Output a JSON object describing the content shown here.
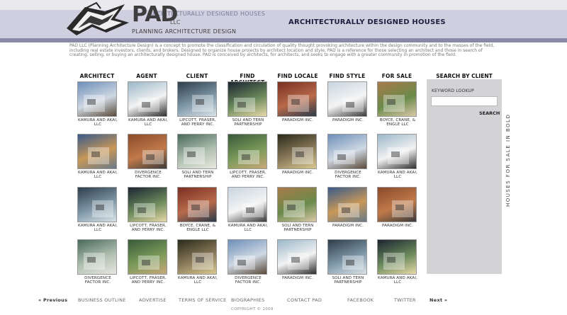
{
  "header": {
    "logo_text": "PAD",
    "logo_llc": "LLC",
    "logo_tag_top": "ARCHITECTURALLY DESIGNED HOUSES",
    "logo_tagline": "PLANNING ARCHITECTURE DESIGN",
    "title": "ARCHITECTURALLY DESIGNED HOUSES"
  },
  "intro": "PAD LLC (Planning Architecture Design) is a concept to promote the classification and circulation of quality thought provoking architecture within the design community and to the masses of the field, including real estate investors, clients, and brokers. Designed to organize house projects by architect location and style, PAD is a reference for those selecting an architect and those in search of creating, selling, or buying an architecturally designed house. PAD is conceived by architects, for architects, and seeks to engage with a greater community in promotion of the field.",
  "columns": [
    "ARCHITECT",
    "AGENT",
    "CLIENT",
    "FIND ARCHITECT",
    "FIND LOCALE",
    "FIND STYLE",
    "FOR SALE"
  ],
  "grid": [
    [
      "KAMURA AND AKAI, LLC",
      "KAMURA AND AKAI, LLC",
      "LIPCOTT, FRASER, AND PERRY INC.",
      "SOLI AND TERN PARTNERSHIP",
      "PARADIGM INC.",
      "PARADIGM INC.",
      "BOYCE, CRANE, & ENGLE LLC"
    ],
    [
      "KAMURA AND AKAI, LLC",
      "DIVERGENCE FACTOR INC.",
      "SOLI AND TERN PARTNERSHIP",
      "LIPCOTT, FRASER, AND PERRY INC.",
      "PARADIGM INC.",
      "DIVERGENCE FACTOR INC.",
      "KAMURA AND AKAI, LLC"
    ],
    [
      "KAMURA AND AKAI, LLC",
      "LIPCOTT, FRASER, AND PERRY INC.",
      "BOYCE, CRANE, & ENGLE LLC",
      "KAMURA AND AKAI, LLC",
      "SOLI AND TERN PARTNERSHIP",
      "PARADIGM INC.",
      "PARADIGM INC."
    ],
    [
      "DIVERGENCE FACTOR INC.",
      "LIPCOTT, FRASER, AND PERRY INC.",
      "KAMURA AND AKAI, LLC",
      "DIVERGENCE FACTOR INC.",
      "PARADIGM INC.",
      "SOLI AND TERN PARTNERSHIP",
      "KAMURA AND AKAI, LLC"
    ]
  ],
  "sidebar": {
    "heading": "SEARCH BY CLIENT",
    "keyword_label": "KEYWORD LOOKUP",
    "keyword_value": "",
    "search_label": "SEARCH",
    "vertical_text": "HOUSES FOR SALE IN BOLD"
  },
  "footer": {
    "prev": "« Previous",
    "links": [
      "BUSINESS OUTLINE",
      "ADVERTISE",
      "TERMS OF SERVICE",
      "BIOGRAPHIES",
      "CONTACT PAD",
      "FACEBOOK",
      "TWITTER"
    ],
    "next": "Next »",
    "copyright": "COPYRIGHT © 2009"
  },
  "colors": {
    "header_band": "#cfcfe0",
    "header_accent": "#8a8aa8",
    "sidebar_bg": "#d3d3d6"
  }
}
